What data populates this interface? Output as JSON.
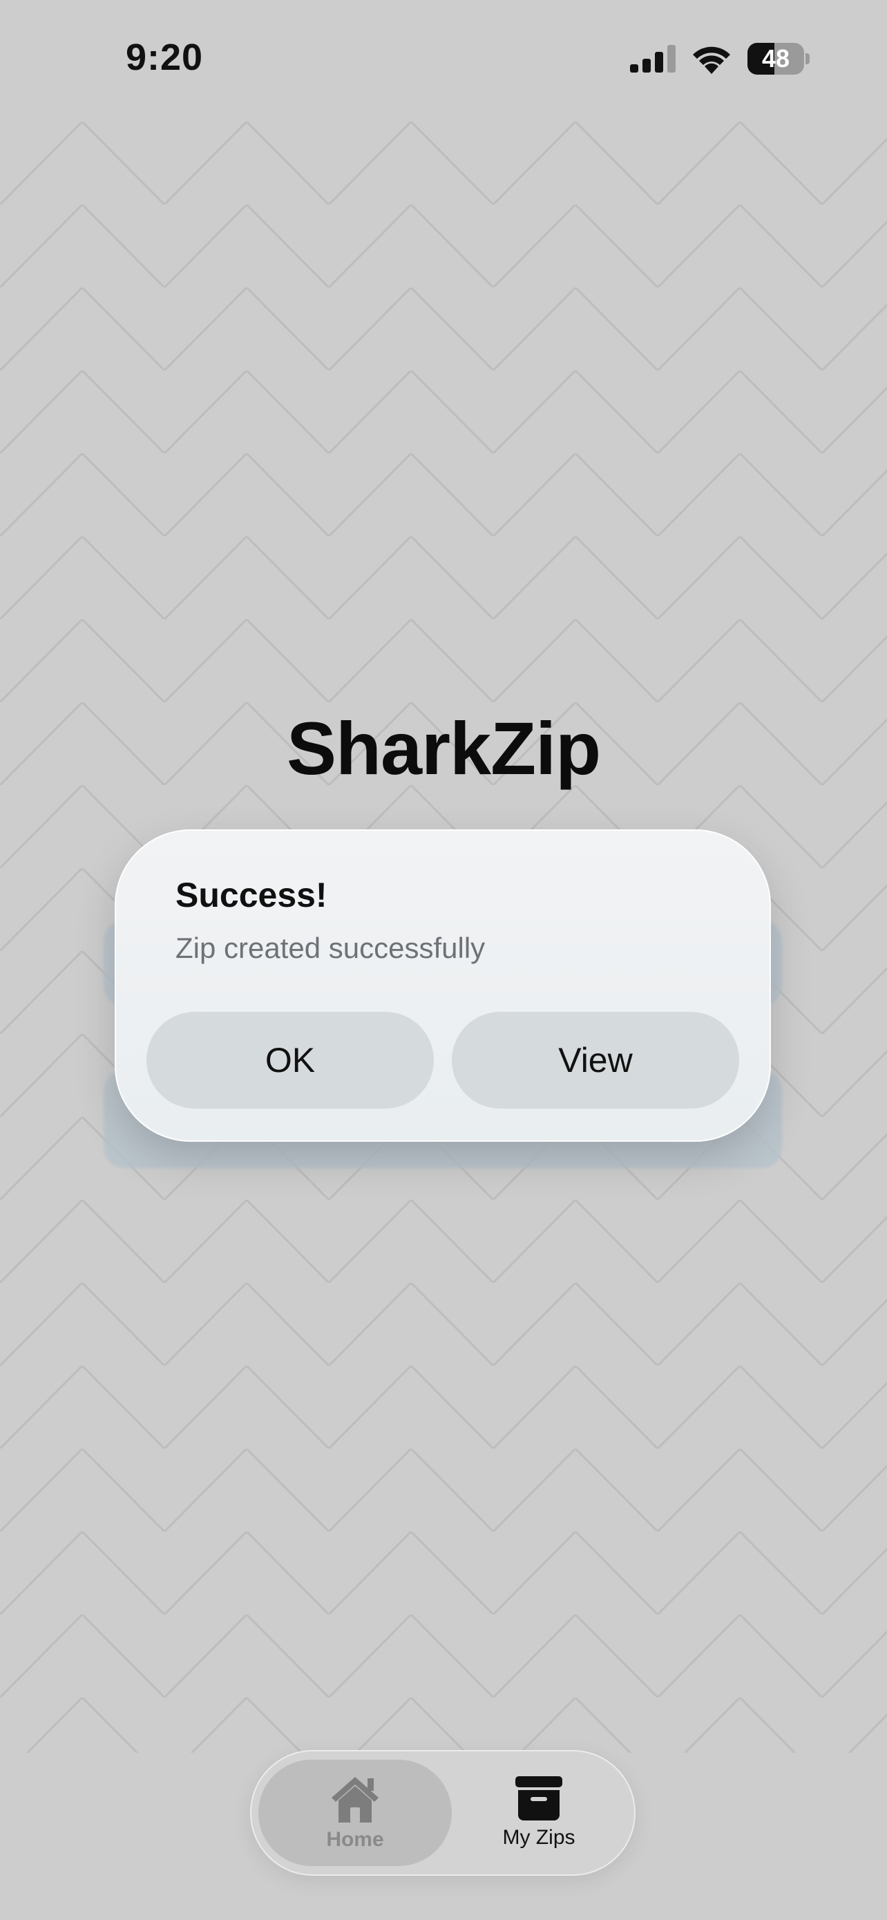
{
  "status_bar": {
    "time": "9:20",
    "battery_level": "48",
    "battery_fraction": 0.48,
    "icons": [
      "cellular-signal-icon",
      "wifi-icon",
      "battery-icon"
    ]
  },
  "app": {
    "title": "SharkZip"
  },
  "alert": {
    "title": "Success!",
    "message": "Zip created successfully",
    "ok_label": "OK",
    "view_label": "View"
  },
  "tab_bar": {
    "items": [
      {
        "label": "Home",
        "icon": "house-icon",
        "selected": true
      },
      {
        "label": "My Zips",
        "icon": "archive-box-icon",
        "selected": false
      }
    ]
  },
  "colors": {
    "background": "#cdcdcd",
    "alert_background": "#eef1f3",
    "alert_button": "#d5dadd",
    "underlying_button": "#b8c4cc"
  }
}
